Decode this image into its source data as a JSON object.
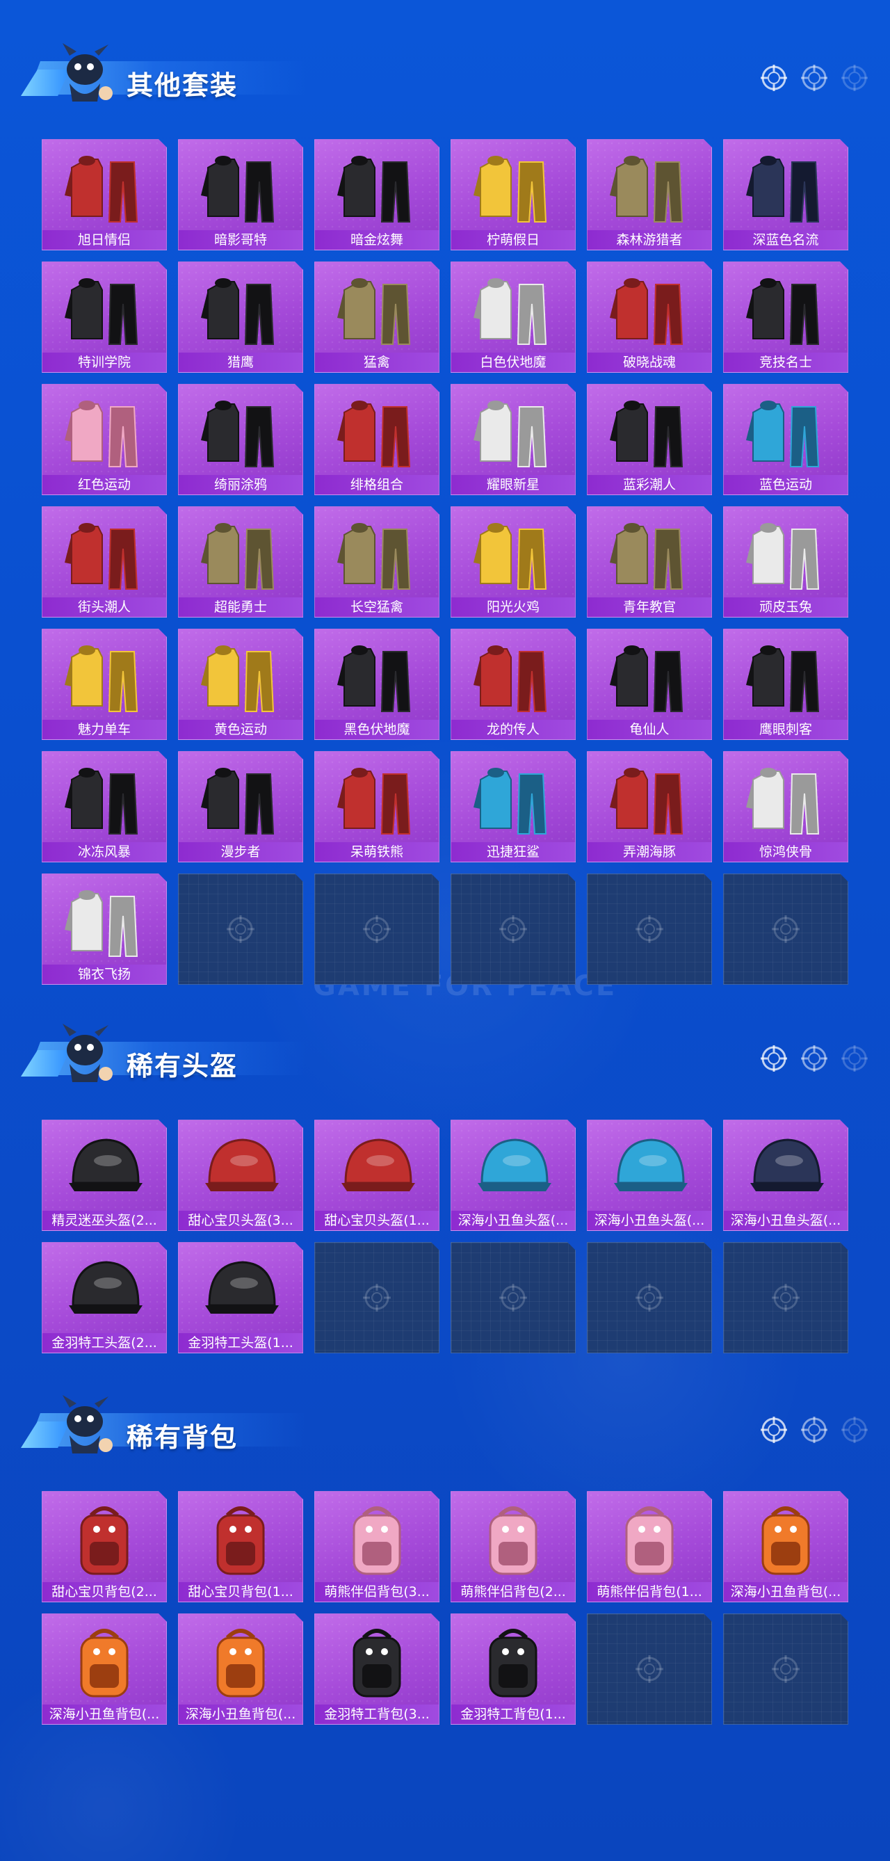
{
  "sections": {
    "outfits": {
      "title": "其他套装",
      "items": [
        {
          "name": "旭日情侣",
          "art": "red-hood-suit"
        },
        {
          "name": "暗影哥特",
          "art": "black-goth-suit"
        },
        {
          "name": "暗金炫舞",
          "art": "black-gold-jacket"
        },
        {
          "name": "柠萌假日",
          "art": "yellow-dress"
        },
        {
          "name": "森林游猎者",
          "art": "camo-suit"
        },
        {
          "name": "深蓝色名流",
          "art": "navy-suit"
        },
        {
          "name": "特训学院",
          "art": "school-uniform"
        },
        {
          "name": "猎鹰",
          "art": "leather-jacket"
        },
        {
          "name": "猛禽",
          "art": "khaki-hoodie"
        },
        {
          "name": "白色伏地魔",
          "art": "white-hoodie"
        },
        {
          "name": "破晓战魂",
          "art": "red-coat"
        },
        {
          "name": "竞技名士",
          "art": "sport-suit"
        },
        {
          "name": "红色运动",
          "art": "pink-track-suit"
        },
        {
          "name": "绮丽涂鸦",
          "art": "graffiti-jacket"
        },
        {
          "name": "绯格组合",
          "art": "red-plaid-set"
        },
        {
          "name": "耀眼新星",
          "art": "white-shirt"
        },
        {
          "name": "蓝彩潮人",
          "art": "black-street"
        },
        {
          "name": "蓝色运动",
          "art": "cyan-track-suit"
        },
        {
          "name": "街头潮人",
          "art": "red-puffer"
        },
        {
          "name": "超能勇士",
          "art": "olive-vest"
        },
        {
          "name": "长空猛禽",
          "art": "camo-jacket"
        },
        {
          "name": "阳光火鸡",
          "art": "yellow-blue-suit"
        },
        {
          "name": "青年教官",
          "art": "officer-suit"
        },
        {
          "name": "顽皮玉兔",
          "art": "bunny-suit"
        },
        {
          "name": "魅力单车",
          "art": "yellow-tee"
        },
        {
          "name": "黄色运动",
          "art": "yellow-jacket"
        },
        {
          "name": "黑色伏地魔",
          "art": "black-hoodie"
        },
        {
          "name": "龙的传人",
          "art": "red-qipao"
        },
        {
          "name": "龟仙人",
          "art": "hawaii-shirt"
        },
        {
          "name": "鹰眼刺客",
          "art": "assassin-suit"
        },
        {
          "name": "冰冻风暴",
          "art": "storm-suit"
        },
        {
          "name": "漫步者",
          "art": "black-trench"
        },
        {
          "name": "呆萌铁熊",
          "art": "bear-outfit"
        },
        {
          "name": "迅捷狂鲨",
          "art": "shark-outfit"
        },
        {
          "name": "弄潮海豚",
          "art": "dolphin-outfit"
        },
        {
          "name": "惊鸿侠骨",
          "art": "wuxia-robe"
        },
        {
          "name": "锦衣飞扬",
          "art": "white-robe"
        }
      ],
      "empty_slots": 5
    },
    "helmets": {
      "title": "稀有头盔",
      "items": [
        {
          "name": "精灵迷巫头盔(2...",
          "art": "elf-helmet"
        },
        {
          "name": "甜心宝贝头盔(3...",
          "art": "yellow-cake-helmet"
        },
        {
          "name": "甜心宝贝头盔(1...",
          "art": "red-moto-helmet"
        },
        {
          "name": "深海小丑鱼头盔(...",
          "art": "blue-visor-helmet"
        },
        {
          "name": "深海小丑鱼头盔(...",
          "art": "teal-helmet"
        },
        {
          "name": "深海小丑鱼头盔(...",
          "art": "navy-helmet"
        },
        {
          "name": "金羽特工头盔(2...",
          "art": "black-gold-helmet"
        },
        {
          "name": "金羽特工头盔(1...",
          "art": "black-gold-helmet-2"
        }
      ],
      "empty_slots": 4
    },
    "backpacks": {
      "title": "稀有背包",
      "items": [
        {
          "name": "甜心宝贝背包(2...",
          "art": "cake-backpack"
        },
        {
          "name": "甜心宝贝背包(1...",
          "art": "cake-backpack-2"
        },
        {
          "name": "萌熊伴侣背包(3...",
          "art": "pink-bear-backpack"
        },
        {
          "name": "萌熊伴侣背包(2...",
          "art": "pink-bear-backpack-2"
        },
        {
          "name": "萌熊伴侣背包(1...",
          "art": "pink-bear-backpack-3"
        },
        {
          "name": "深海小丑鱼背包(...",
          "art": "clownfish-backpack"
        },
        {
          "name": "深海小丑鱼背包(...",
          "art": "clownfish-backpack-2"
        },
        {
          "name": "深海小丑鱼背包(...",
          "art": "clownfish-backpack-3"
        },
        {
          "name": "金羽特工背包(3...",
          "art": "black-backpack"
        },
        {
          "name": "金羽特工背包(1...",
          "art": "black-backpack-2"
        }
      ],
      "empty_slots": 2
    }
  },
  "watermark": "GAME FOR PEACE",
  "colors": {
    "background": "#0b52d4",
    "card_purple": "#a54ad9",
    "label_purple": "#8e2bd0",
    "empty_slot": "#1e3c72"
  }
}
